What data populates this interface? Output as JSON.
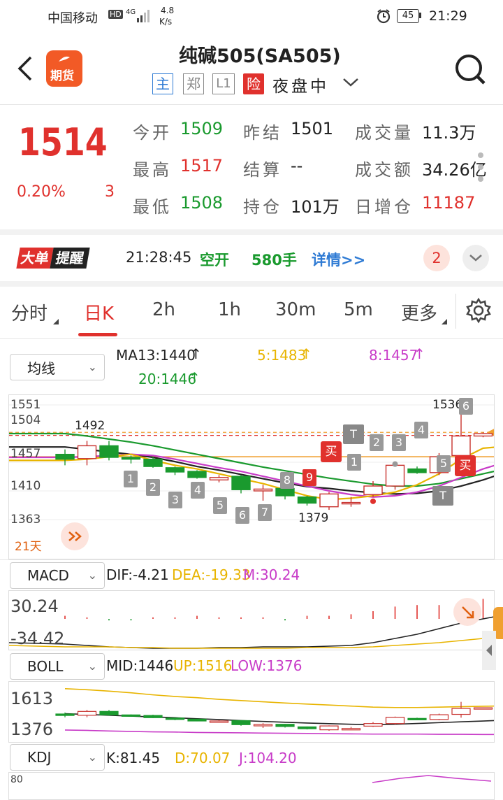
{
  "status_bar": {
    "carrier": "中国移动",
    "hd": "HD",
    "net": "4G",
    "speed_value": "4.8",
    "speed_unit": "K/s",
    "battery": "45",
    "time": "21:29"
  },
  "header": {
    "title": "纯碱505(SA505)",
    "logo_text": "期货",
    "tag_main": "主",
    "tag_zheng": "郑",
    "tag_l1": "L1",
    "tag_risk": "险",
    "session": "夜盘中"
  },
  "quote": {
    "last_price": "1514",
    "change_pct": "0.20%",
    "change": "3",
    "fields": [
      {
        "label": "今开",
        "value": "1509",
        "color": "green"
      },
      {
        "label": "昨结",
        "value": "1501",
        "color": "black"
      },
      {
        "label": "成交量",
        "value": "11.3万",
        "color": "black"
      },
      {
        "label": "最高",
        "value": "1517",
        "color": "red"
      },
      {
        "label": "结算",
        "value": "--",
        "color": "black"
      },
      {
        "label": "成交额",
        "value": "34.26亿",
        "color": "black"
      },
      {
        "label": "最低",
        "value": "1508",
        "color": "green"
      },
      {
        "label": "持仓",
        "value": "101万",
        "color": "black"
      },
      {
        "label": "日增仓",
        "value": "11187",
        "color": "red"
      }
    ]
  },
  "alert": {
    "badge_big": "大单",
    "badge_remind": "提醒",
    "time": "21:28:45",
    "action": "空开",
    "volume": "580手",
    "detail": "详情>>",
    "count": "2"
  },
  "tabs": [
    {
      "label": "分时",
      "active": false
    },
    {
      "label": "日K",
      "active": true
    },
    {
      "label": "2h",
      "active": false
    },
    {
      "label": "1h",
      "active": false
    },
    {
      "label": "30m",
      "active": false
    },
    {
      "label": "5m",
      "active": false
    },
    {
      "label": "更多",
      "active": false
    }
  ],
  "ma": {
    "selector": "均线",
    "ma13": "MA13:1440",
    "ma5": "5:1483",
    "ma8": "8:1457",
    "ma20": "20:1446"
  },
  "kline": {
    "y_labels": [
      "1551",
      "1504",
      "1457",
      "1410",
      "1363"
    ],
    "high_mark": "1536",
    "high_seq": "6",
    "low_mark": "1379",
    "left_mark": "1492",
    "period": "21天",
    "signals": {
      "buy": "买",
      "t": "T"
    },
    "seq_down": [
      "1",
      "2",
      "3",
      "4",
      "5",
      "6",
      "7",
      "8",
      "9"
    ],
    "seq_up": [
      "1",
      "2",
      "3",
      "4",
      "5"
    ]
  },
  "macd": {
    "selector": "MACD",
    "dif": "DIF:-4.21",
    "dea": "DEA:-19.33",
    "m": "M:30.24",
    "y_top": "30.24",
    "y_bottom": "-34.42"
  },
  "boll": {
    "selector": "BOLL",
    "mid": "MID:1446",
    "up": "UP:1516",
    "low": "LOW:1376",
    "y_top": "1613",
    "y_bottom": "1376"
  },
  "kdj": {
    "selector": "KDJ",
    "k": "K:81.45",
    "d": "D:70.07",
    "j": "J:104.20",
    "y_top": "80"
  },
  "colors": {
    "red": "#e0312d",
    "green": "#1a9a2e",
    "blue": "#2f7bd4",
    "yellow": "#e8b400",
    "magenta": "#c83cc8",
    "orange": "#f0a030"
  },
  "chart_data": {
    "type": "candlestick",
    "candles": [
      {
        "o": 1470,
        "c": 1462,
        "h": 1478,
        "l": 1452
      },
      {
        "o": 1463,
        "c": 1484,
        "h": 1492,
        "l": 1452
      },
      {
        "o": 1484,
        "c": 1465,
        "h": 1492,
        "l": 1460
      },
      {
        "o": 1465,
        "c": 1462,
        "h": 1468,
        "l": 1455
      },
      {
        "o": 1462,
        "c": 1450,
        "h": 1466,
        "l": 1448
      },
      {
        "o": 1448,
        "c": 1441,
        "h": 1450,
        "l": 1436
      },
      {
        "o": 1442,
        "c": 1432,
        "h": 1444,
        "l": 1430
      },
      {
        "o": 1428,
        "c": 1432,
        "h": 1436,
        "l": 1424
      },
      {
        "o": 1434,
        "c": 1412,
        "h": 1436,
        "l": 1406
      },
      {
        "o": 1410,
        "c": 1413,
        "h": 1420,
        "l": 1394
      },
      {
        "o": 1414,
        "c": 1402,
        "h": 1416,
        "l": 1396
      },
      {
        "o": 1400,
        "c": 1390,
        "h": 1402,
        "l": 1386
      },
      {
        "o": 1384,
        "c": 1405,
        "h": 1408,
        "l": 1379
      },
      {
        "o": 1390,
        "c": 1391,
        "h": 1400,
        "l": 1384
      },
      {
        "o": 1404,
        "c": 1418,
        "h": 1426,
        "l": 1400
      },
      {
        "o": 1418,
        "c": 1452,
        "h": 1456,
        "l": 1412
      },
      {
        "o": 1446,
        "c": 1440,
        "h": 1450,
        "l": 1438
      },
      {
        "o": 1440,
        "c": 1466,
        "h": 1472,
        "l": 1436
      },
      {
        "o": 1468,
        "c": 1500,
        "h": 1536,
        "l": 1450
      },
      {
        "o": 1500,
        "c": 1504,
        "h": 1506,
        "l": 1498
      },
      {
        "o": 1509,
        "c": 1514,
        "h": 1517,
        "l": 1508
      }
    ],
    "ma13": [
      1482,
      1478,
      1474,
      1470,
      1465,
      1458,
      1450,
      1444,
      1437,
      1430,
      1423,
      1417,
      1414,
      1410,
      1407,
      1405,
      1406,
      1410,
      1418,
      1428,
      1440
    ],
    "ma5": [
      1460,
      1462,
      1466,
      1470,
      1460,
      1452,
      1446,
      1438,
      1430,
      1422,
      1412,
      1402,
      1396,
      1398,
      1402,
      1408,
      1420,
      1438,
      1462,
      1480,
      1483
    ],
    "ma8": [
      1465,
      1466,
      1468,
      1470,
      1468,
      1462,
      1455,
      1448,
      1442,
      1434,
      1426,
      1418,
      1410,
      1404,
      1400,
      1402,
      1408,
      1418,
      1432,
      1446,
      1457
    ],
    "ma20": [
      1504,
      1500,
      1495,
      1490,
      1484,
      1477,
      1470,
      1463,
      1456,
      1449,
      1443,
      1437,
      1431,
      1426,
      1421,
      1418,
      1418,
      1422,
      1430,
      1438,
      1446
    ],
    "ylim": [
      1363,
      1551
    ]
  }
}
